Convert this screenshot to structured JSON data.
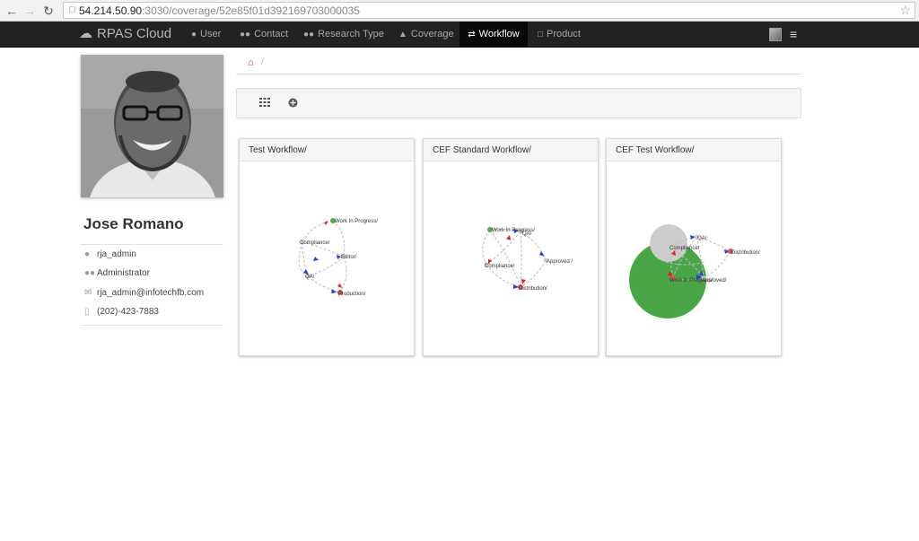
{
  "browser": {
    "url_host": "54.214.50.90",
    "url_rest": ":3030/coverage/52e85f01d392169703000035",
    "back_icon": "arrow-left-icon",
    "forward_icon": "arrow-right-icon",
    "reload_icon": "reload-icon",
    "bookmark_icon": "star-icon"
  },
  "navbar": {
    "brand": "RPAS Cloud",
    "items": [
      {
        "label": "User",
        "icon": "user-icon"
      },
      {
        "label": "Contact",
        "icon": "users-icon"
      },
      {
        "label": "Research Type",
        "icon": "users-icon"
      },
      {
        "label": "Coverage",
        "icon": "sitemap-icon"
      },
      {
        "label": "Workflow",
        "icon": "exchange-icon",
        "active": true
      },
      {
        "label": "Product",
        "icon": "file-icon"
      }
    ]
  },
  "profile": {
    "name": "Jose Romano",
    "username": "rja_admin",
    "role": "Administrator",
    "email": "rja_admin@infotechfb.com",
    "phone": "(202)-423-7883"
  },
  "breadcrumb": {
    "separator": "/"
  },
  "workflows": [
    {
      "title": "Test Workflow/",
      "nodes": [
        "Work In Progress/",
        "Compliance/",
        "Editor/",
        "QA/",
        "Production/"
      ]
    },
    {
      "title": "CEF Standard Workflow/",
      "nodes": [
        "Work In Progress/",
        "QA/",
        "Approved /",
        "Compliance/",
        "Distribution/"
      ]
    },
    {
      "title": "CEF Test Workflow/",
      "nodes": [
        "QA/",
        "Compliance/",
        "Distribution/",
        "Work In Progress/",
        "Approved/"
      ]
    }
  ],
  "colors": {
    "navbar_bg": "#222222",
    "home_icon": "#c9302c",
    "node_green": "#4cae4c",
    "node_red": "#d9534f",
    "arrow_blue": "#2a3fd6",
    "arrow_red": "#e02020",
    "bubble_green": "#4aa546",
    "bubble_grey": "#cccccc"
  }
}
